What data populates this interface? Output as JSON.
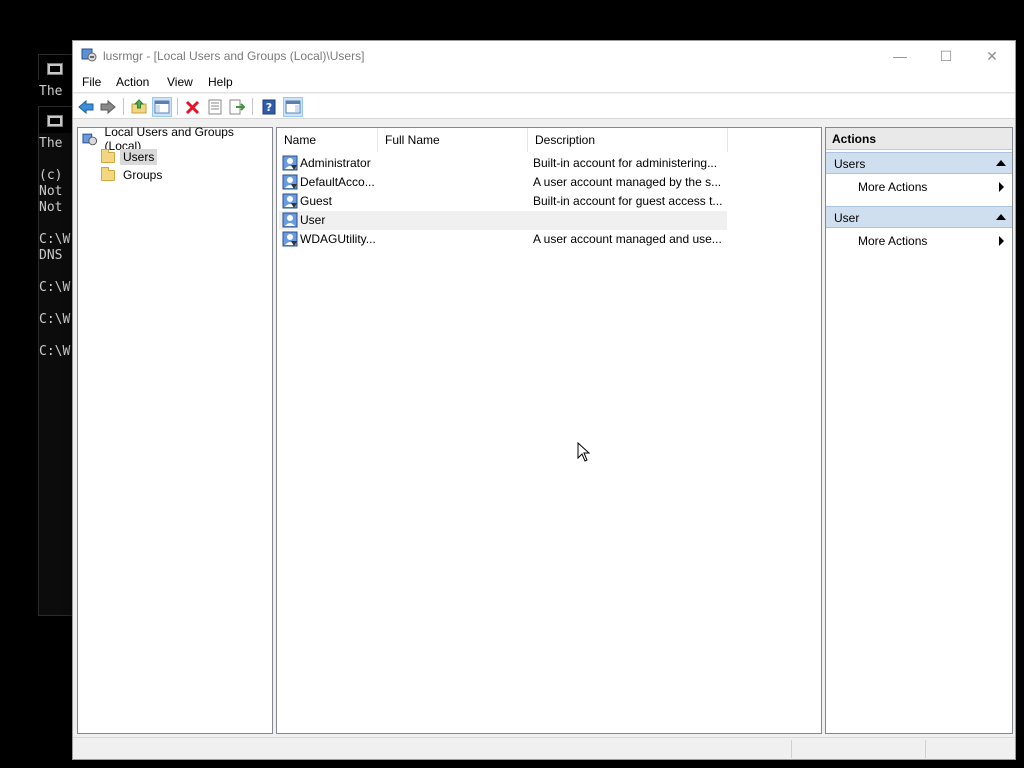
{
  "window": {
    "title": "lusrmgr - [Local Users and Groups (Local)\\Users]",
    "controls": {
      "minimize": "—",
      "maximize": "☐",
      "close": "✕"
    }
  },
  "menu": [
    "File",
    "Action",
    "View",
    "Help"
  ],
  "toolbar": {
    "buttons": [
      "back-icon",
      "forward-icon",
      "up-folder-icon",
      "show-hide-console-tree-icon",
      "delete-icon",
      "properties-icon",
      "export-list-icon",
      "help-icon",
      "show-hide-action-pane-icon"
    ]
  },
  "tree": {
    "root": "Local Users and Groups (Local)",
    "children": [
      "Users",
      "Groups"
    ],
    "selected": "Users"
  },
  "list": {
    "columns": [
      "Name",
      "Full Name",
      "Description"
    ],
    "rows": [
      {
        "name": "Administrator",
        "full_name": "",
        "description": "Built-in account for administering..."
      },
      {
        "name": "DefaultAcco...",
        "full_name": "",
        "description": "A user account managed by the s..."
      },
      {
        "name": "Guest",
        "full_name": "",
        "description": "Built-in account for guest access t..."
      },
      {
        "name": "User",
        "full_name": "",
        "description": ""
      },
      {
        "name": "WDAGUtility...",
        "full_name": "",
        "description": "A user account managed and use..."
      }
    ]
  },
  "actions": {
    "header": "Actions",
    "groups": [
      {
        "title": "Users",
        "items": [
          "More Actions"
        ]
      },
      {
        "title": "User",
        "items": [
          "More Actions"
        ]
      }
    ]
  },
  "console": {
    "lines_top": [
      "The"
    ],
    "lines_bottom": [
      "The",
      "",
      "(c)",
      "Not",
      "Not",
      "",
      "C:\\W",
      "DNS",
      "",
      "C:\\W",
      "",
      "C:\\W",
      "",
      "C:\\W"
    ]
  },
  "colors": {
    "accent": "#0078d7",
    "action_group_bg": "#cfdff0",
    "delete_red": "#e81123"
  }
}
